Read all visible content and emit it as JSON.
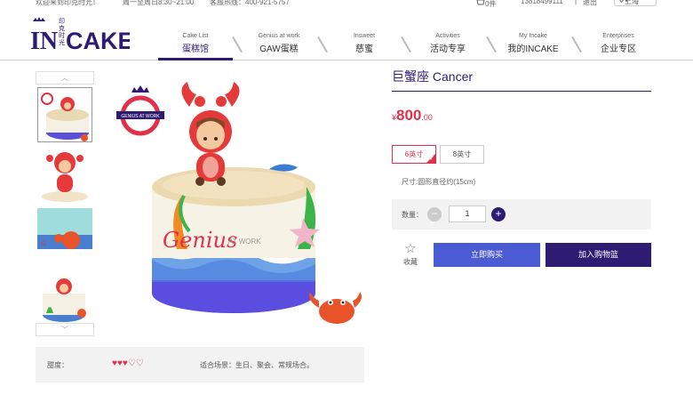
{
  "topbar": {
    "welcome": "欢迎来到印克时光！",
    "hours": "周一至周日8:30~21:00",
    "hotline": "客服热线：400-921-5757",
    "cart": "0件",
    "phone": "13818499111",
    "separator": "|",
    "logout": "退出",
    "city": "上海"
  },
  "logo": {
    "brand_left": "IN",
    "brand_right": "CAKE",
    "brand_cn": "印克时光"
  },
  "nav": [
    {
      "en": "Cake List",
      "cn": "蛋糕馆"
    },
    {
      "en": "Genius at work",
      "cn": "GAW蛋糕"
    },
    {
      "en": "Insweet",
      "cn": "慈蜜"
    },
    {
      "en": "Activities",
      "cn": "活动专享"
    },
    {
      "en": "My Incake",
      "cn": "我的INCAKE"
    },
    {
      "en": "Enterprises",
      "cn": "企业专区"
    }
  ],
  "product": {
    "title": "巨蟹座 Cancer",
    "currency": "¥",
    "price_int": "800",
    "price_dec": ".00",
    "sizes": [
      "6英寸",
      "8英寸"
    ],
    "selected_size": "6英寸",
    "size_note": "尺寸:圆形直径约(15cm)",
    "qty_label": "数量：",
    "qty": "1",
    "minus": "−",
    "plus": "+",
    "fav_label": "收藏",
    "buy_label": "立即购买",
    "cart_label": "加入购物篮",
    "sweetness_label": "甜度：",
    "sweetness_hearts": "♥♥♥♡♡",
    "sweetness_level": 3,
    "occasion": "适合场景：生日、聚会、常规场合。",
    "badge_text": "GENIUS AT WORK",
    "cake_text": "Genius",
    "cake_text_small": "AT WORK"
  },
  "thumbs": {
    "up": "︿",
    "down": "﹀"
  },
  "colors": {
    "brand": "#2e1c73",
    "accent": "#e0304a",
    "buy": "#4a5bd3"
  }
}
